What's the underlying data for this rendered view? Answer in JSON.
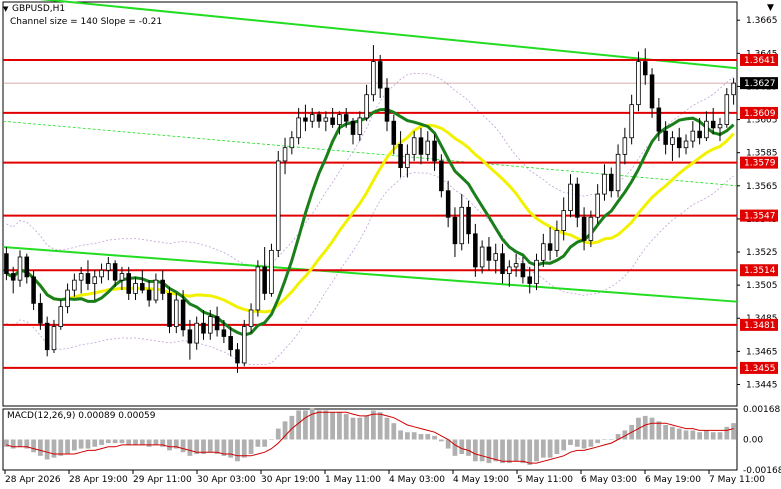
{
  "window": {
    "title": "GBPUSD,H1",
    "info": "Channel size = 140 Slope = -0.21",
    "collapse_glyph": "▼",
    "menu_glyph": "▼"
  },
  "chart_data": {
    "type": "candlestick",
    "symbol": "GBPUSD",
    "timeframe": "H1",
    "y_axis": {
      "ylim": [
        1.3432,
        1.3676
      ],
      "ticks": [
        "1.3665",
        "1.3645",
        "1.3625",
        "1.3605",
        "1.3585",
        "1.3565",
        "1.3545",
        "1.3525",
        "1.3505",
        "1.3485",
        "1.3465",
        "1.3445"
      ]
    },
    "x_axis": {
      "ticks": [
        "28 Apr 2026",
        "28 Apr 19:00",
        "29 Apr 11:00",
        "30 Apr 03:00",
        "30 Apr 19:00",
        "1 May 11:00",
        "4 May 03:00",
        "4 May 19:00",
        "5 May 11:00",
        "6 May 03:00",
        "6 May 19:00",
        "7 May 11:00"
      ]
    },
    "levels": [
      {
        "value": 1.3641,
        "label": "1.3641"
      },
      {
        "value": 1.3609,
        "label": "1.3609"
      },
      {
        "value": 1.3579,
        "label": "1.3579"
      },
      {
        "value": 1.3547,
        "label": "1.3547"
      },
      {
        "value": 1.3514,
        "label": "1.3514"
      },
      {
        "value": 1.3481,
        "label": "1.3481"
      },
      {
        "value": 1.3455,
        "label": "1.3455"
      }
    ],
    "current_price": {
      "value": 1.3627,
      "label": "1.3627"
    },
    "colors": {
      "level": "#e00000",
      "channel": "#22dd22",
      "ma_fast": "#1a7f1a",
      "ma_slow": "#f2f200",
      "envelope": "#c0a0d8",
      "candle": "#000000",
      "macd_hist": "#b0b0b0",
      "macd_signal": "#d00000",
      "label_bg": "#e00000",
      "current_bg": "#000000"
    },
    "ohlc": [
      [
        1.3524,
        1.3528,
        1.3508,
        1.3512
      ],
      [
        1.3512,
        1.3516,
        1.35,
        1.3508
      ],
      [
        1.3508,
        1.3526,
        1.3504,
        1.3522
      ],
      [
        1.3522,
        1.3524,
        1.3506,
        1.351
      ],
      [
        1.351,
        1.3514,
        1.349,
        1.3494
      ],
      [
        1.3494,
        1.35,
        1.3478,
        1.3482
      ],
      [
        1.3482,
        1.3486,
        1.3462,
        1.3466
      ],
      [
        1.3466,
        1.3484,
        1.3464,
        1.348
      ],
      [
        1.348,
        1.3496,
        1.3478,
        1.3492
      ],
      [
        1.3492,
        1.3506,
        1.3488,
        1.3502
      ],
      [
        1.3502,
        1.3512,
        1.3498,
        1.3508
      ],
      [
        1.3508,
        1.3516,
        1.35,
        1.3512
      ],
      [
        1.3512,
        1.352,
        1.3502,
        1.3506
      ],
      [
        1.3506,
        1.3514,
        1.3496,
        1.351
      ],
      [
        1.351,
        1.3518,
        1.3506,
        1.3514
      ],
      [
        1.3514,
        1.3522,
        1.3508,
        1.3518
      ],
      [
        1.3518,
        1.352,
        1.3504,
        1.3508
      ],
      [
        1.3508,
        1.3516,
        1.3502,
        1.3512
      ],
      [
        1.3512,
        1.3516,
        1.3496,
        1.35
      ],
      [
        1.35,
        1.351,
        1.3496,
        1.3506
      ],
      [
        1.3506,
        1.3514,
        1.35,
        1.3502
      ],
      [
        1.3502,
        1.3508,
        1.3492,
        1.3496
      ],
      [
        1.3496,
        1.3512,
        1.3494,
        1.3508
      ],
      [
        1.3508,
        1.3514,
        1.3496,
        1.35
      ],
      [
        1.35,
        1.3504,
        1.3476,
        1.348
      ],
      [
        1.348,
        1.35,
        1.3476,
        1.3496
      ],
      [
        1.3496,
        1.3502,
        1.3474,
        1.3478
      ],
      [
        1.3478,
        1.3484,
        1.346,
        1.347
      ],
      [
        1.347,
        1.3486,
        1.3466,
        1.3482
      ],
      [
        1.3482,
        1.349,
        1.3472,
        1.3476
      ],
      [
        1.3476,
        1.349,
        1.3472,
        1.3486
      ],
      [
        1.3486,
        1.3492,
        1.3474,
        1.3478
      ],
      [
        1.3478,
        1.3484,
        1.347,
        1.3474
      ],
      [
        1.3474,
        1.348,
        1.3462,
        1.3466
      ],
      [
        1.3466,
        1.347,
        1.3452,
        1.3458
      ],
      [
        1.3458,
        1.3484,
        1.3456,
        1.348
      ],
      [
        1.348,
        1.3494,
        1.3476,
        1.349
      ],
      [
        1.349,
        1.352,
        1.3486,
        1.3516
      ],
      [
        1.3516,
        1.3528,
        1.3496,
        1.35
      ],
      [
        1.35,
        1.353,
        1.3498,
        1.3526
      ],
      [
        1.3526,
        1.3586,
        1.3522,
        1.358
      ],
      [
        1.358,
        1.3594,
        1.3572,
        1.3588
      ],
      [
        1.3588,
        1.3598,
        1.3584,
        1.3594
      ],
      [
        1.3594,
        1.3612,
        1.359,
        1.3606
      ],
      [
        1.3606,
        1.3614,
        1.3598,
        1.3604
      ],
      [
        1.3604,
        1.3612,
        1.36,
        1.3608
      ],
      [
        1.3608,
        1.361,
        1.36,
        1.3604
      ],
      [
        1.3604,
        1.361,
        1.3598,
        1.3606
      ],
      [
        1.3606,
        1.3612,
        1.36,
        1.3602
      ],
      [
        1.3602,
        1.361,
        1.3596,
        1.3608
      ],
      [
        1.3608,
        1.3612,
        1.36,
        1.3604
      ],
      [
        1.3604,
        1.3606,
        1.359,
        1.3596
      ],
      [
        1.3596,
        1.361,
        1.3592,
        1.3606
      ],
      [
        1.3606,
        1.3626,
        1.3604,
        1.362
      ],
      [
        1.362,
        1.365,
        1.3616,
        1.364
      ],
      [
        1.364,
        1.3644,
        1.3618,
        1.3624
      ],
      [
        1.3624,
        1.363,
        1.3598,
        1.3604
      ],
      [
        1.3604,
        1.3608,
        1.3584,
        1.359
      ],
      [
        1.359,
        1.3598,
        1.357,
        1.3576
      ],
      [
        1.3576,
        1.359,
        1.357,
        1.3584
      ],
      [
        1.3584,
        1.3598,
        1.358,
        1.3594
      ],
      [
        1.3594,
        1.36,
        1.3578,
        1.3584
      ],
      [
        1.3584,
        1.3598,
        1.358,
        1.3592
      ],
      [
        1.3592,
        1.3596,
        1.3574,
        1.358
      ],
      [
        1.358,
        1.3584,
        1.3558,
        1.3562
      ],
      [
        1.3562,
        1.3568,
        1.354,
        1.3546
      ],
      [
        1.3546,
        1.3552,
        1.3522,
        1.353
      ],
      [
        1.353,
        1.356,
        1.3526,
        1.3552
      ],
      [
        1.3552,
        1.3556,
        1.353,
        1.3536
      ],
      [
        1.3536,
        1.3542,
        1.351,
        1.3516
      ],
      [
        1.3516,
        1.3532,
        1.3512,
        1.3528
      ],
      [
        1.3528,
        1.3534,
        1.3514,
        1.352
      ],
      [
        1.352,
        1.353,
        1.3512,
        1.3524
      ],
      [
        1.3524,
        1.353,
        1.3506,
        1.3512
      ],
      [
        1.3512,
        1.352,
        1.3504,
        1.3516
      ],
      [
        1.3516,
        1.3524,
        1.351,
        1.3518
      ],
      [
        1.3518,
        1.3522,
        1.3506,
        1.351
      ],
      [
        1.351,
        1.3516,
        1.35,
        1.3506
      ],
      [
        1.3506,
        1.3524,
        1.3502,
        1.352
      ],
      [
        1.352,
        1.3536,
        1.3516,
        1.353
      ],
      [
        1.353,
        1.354,
        1.352,
        1.3526
      ],
      [
        1.3526,
        1.3544,
        1.3522,
        1.3538
      ],
      [
        1.3538,
        1.3558,
        1.3532,
        1.355
      ],
      [
        1.355,
        1.3572,
        1.3546,
        1.3566
      ],
      [
        1.3566,
        1.357,
        1.354,
        1.3546
      ],
      [
        1.3546,
        1.3552,
        1.3526,
        1.3532
      ],
      [
        1.3532,
        1.355,
        1.3528,
        1.3546
      ],
      [
        1.3546,
        1.3566,
        1.3542,
        1.356
      ],
      [
        1.356,
        1.3578,
        1.3556,
        1.3572
      ],
      [
        1.3572,
        1.3576,
        1.3558,
        1.3562
      ],
      [
        1.3562,
        1.359,
        1.3558,
        1.3584
      ],
      [
        1.3584,
        1.36,
        1.3578,
        1.3594
      ],
      [
        1.3594,
        1.362,
        1.359,
        1.3614
      ],
      [
        1.3614,
        1.3646,
        1.361,
        1.364
      ],
      [
        1.364,
        1.3648,
        1.3626,
        1.3632
      ],
      [
        1.3632,
        1.3636,
        1.3606,
        1.3612
      ],
      [
        1.3612,
        1.3618,
        1.3592,
        1.3598
      ],
      [
        1.3598,
        1.3604,
        1.3584,
        1.359
      ],
      [
        1.359,
        1.3598,
        1.358,
        1.3594
      ],
      [
        1.3594,
        1.36,
        1.3582,
        1.3588
      ],
      [
        1.3588,
        1.3596,
        1.3584,
        1.3592
      ],
      [
        1.3592,
        1.3604,
        1.3588,
        1.3598
      ],
      [
        1.3598,
        1.3606,
        1.359,
        1.3594
      ],
      [
        1.3594,
        1.361,
        1.3592,
        1.3604
      ],
      [
        1.3604,
        1.3612,
        1.3596,
        1.36
      ],
      [
        1.36,
        1.3606,
        1.3592,
        1.3602
      ],
      [
        1.3602,
        1.3624,
        1.36,
        1.362
      ],
      [
        1.362,
        1.363,
        1.3614,
        1.3627
      ]
    ],
    "macd": {
      "label": "MACD(12,26,9) 0.00089 0.00059",
      "ylim": [
        -0.00168,
        0.00168
      ],
      "ticks": [
        "0.00168",
        "0.00",
        "-0.00168"
      ],
      "histogram": [
        -0.0004,
        -0.0005,
        -0.0004,
        -0.0005,
        -0.0007,
        -0.0009,
        -0.0011,
        -0.001,
        -0.0009,
        -0.0008,
        -0.0006,
        -0.0005,
        -0.0005,
        -0.0004,
        -0.0003,
        -0.0002,
        -0.0002,
        -0.0002,
        -0.0003,
        -0.0003,
        -0.0003,
        -0.0004,
        -0.0003,
        -0.0004,
        -0.0006,
        -0.0005,
        -0.0007,
        -0.0009,
        -0.0008,
        -0.0008,
        -0.0007,
        -0.0008,
        -0.0009,
        -0.001,
        -0.0012,
        -0.001,
        -0.0008,
        -0.0004,
        -0.0004,
        0.0,
        0.0006,
        0.001,
        0.0013,
        0.0016,
        0.0016,
        0.0017,
        0.0016,
        0.0016,
        0.0015,
        0.0015,
        0.0014,
        0.0012,
        0.0012,
        0.0013,
        0.0016,
        0.0015,
        0.0012,
        0.0009,
        0.0005,
        0.0004,
        0.0004,
        0.0003,
        0.0003,
        0.0002,
        -0.0001,
        -0.0005,
        -0.0009,
        -0.0008,
        -0.0009,
        -0.0012,
        -0.0012,
        -0.0013,
        -0.0012,
        -0.0013,
        -0.0013,
        -0.0012,
        -0.0013,
        -0.0014,
        -0.0012,
        -0.001,
        -0.001,
        -0.0008,
        -0.0006,
        -0.0003,
        -0.0004,
        -0.0005,
        -0.0004,
        -0.0002,
        0.0,
        0.0,
        0.0003,
        0.0005,
        0.0008,
        0.0012,
        0.0013,
        0.0012,
        0.001,
        0.0008,
        0.0007,
        0.0006,
        0.0005,
        0.0005,
        0.0004,
        0.0005,
        0.0004,
        0.0004,
        0.0007,
        0.0009
      ],
      "signal": [
        -0.0003,
        -0.0004,
        -0.0004,
        -0.0004,
        -0.0005,
        -0.0006,
        -0.0007,
        -0.0008,
        -0.0008,
        -0.0008,
        -0.0008,
        -0.0007,
        -0.0006,
        -0.0006,
        -0.0005,
        -0.0004,
        -0.0004,
        -0.0003,
        -0.0003,
        -0.0003,
        -0.0003,
        -0.0003,
        -0.0003,
        -0.0003,
        -0.0004,
        -0.0004,
        -0.0005,
        -0.0006,
        -0.0007,
        -0.0007,
        -0.0007,
        -0.0007,
        -0.0008,
        -0.0008,
        -0.0009,
        -0.0009,
        -0.0009,
        -0.0008,
        -0.0007,
        -0.0005,
        -0.0002,
        0.0002,
        0.0006,
        0.0009,
        0.0012,
        0.0014,
        0.0015,
        0.0015,
        0.0015,
        0.0015,
        0.0015,
        0.0014,
        0.0013,
        0.0013,
        0.0014,
        0.0014,
        0.0013,
        0.0012,
        0.001,
        0.0008,
        0.0007,
        0.0006,
        0.0005,
        0.0004,
        0.0002,
        0.0,
        -0.0003,
        -0.0005,
        -0.0006,
        -0.0008,
        -0.0009,
        -0.001,
        -0.0011,
        -0.0012,
        -0.0012,
        -0.0012,
        -0.0012,
        -0.0013,
        -0.0013,
        -0.0012,
        -0.0011,
        -0.001,
        -0.0009,
        -0.0007,
        -0.0006,
        -0.0006,
        -0.0005,
        -0.0004,
        -0.0003,
        -0.0002,
        0.0,
        0.0002,
        0.0004,
        0.0006,
        0.0008,
        0.0009,
        0.0009,
        0.0009,
        0.0008,
        0.0007,
        0.0006,
        0.0006,
        0.0005,
        0.0005,
        0.0005,
        0.0005,
        0.0005,
        0.0006
      ]
    }
  }
}
